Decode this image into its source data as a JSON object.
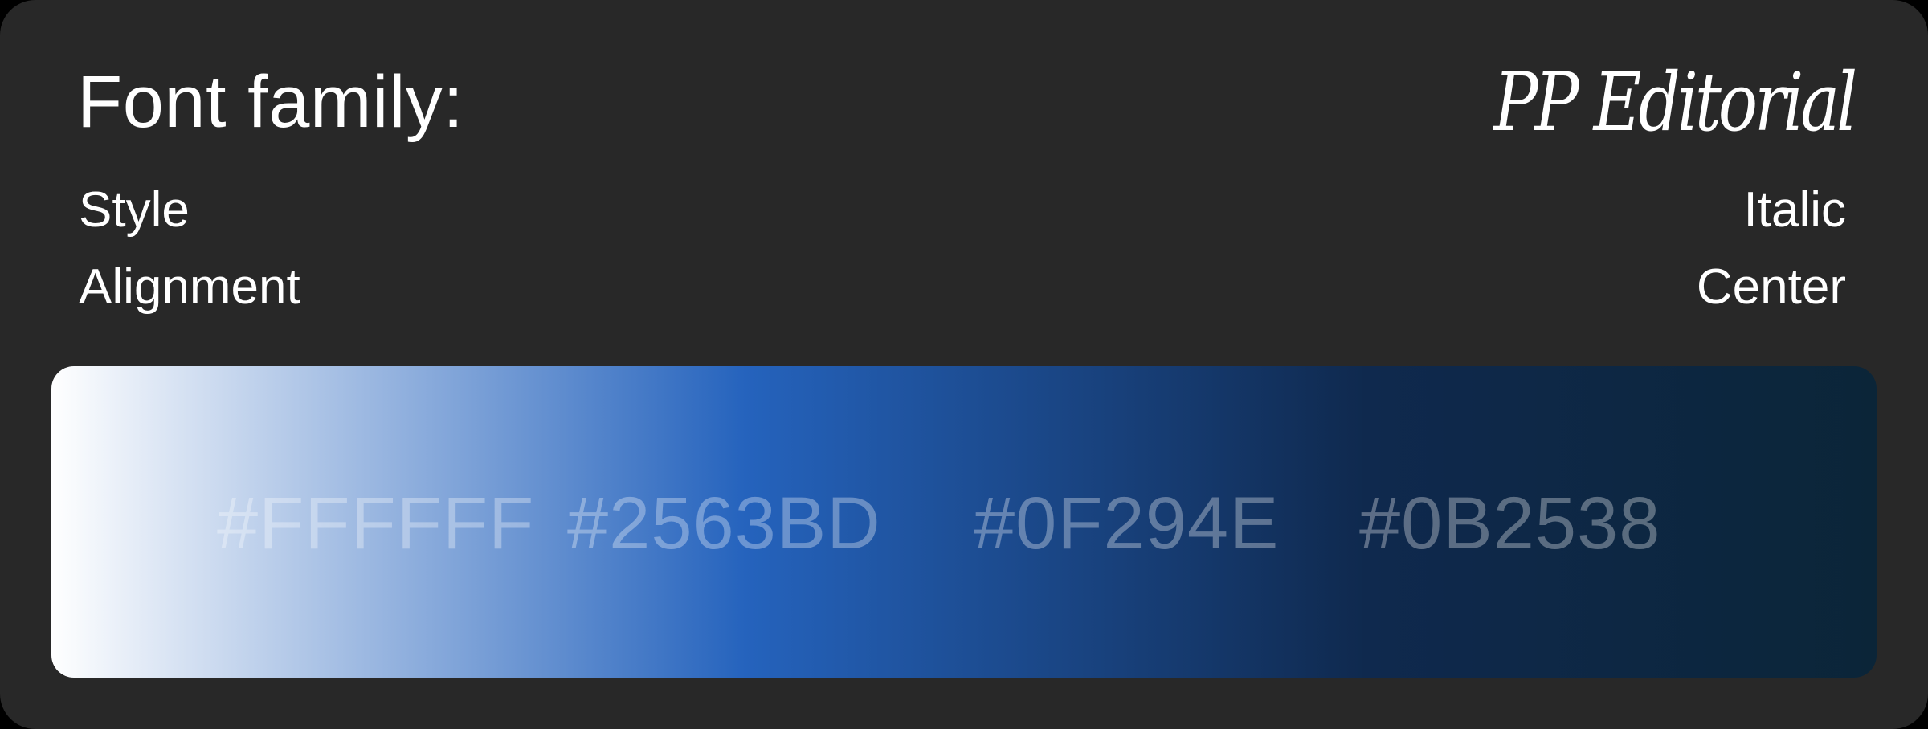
{
  "font_spec": {
    "title_label": "Font family:",
    "title_value": "PP Editorial",
    "style_label": "Style",
    "style_value": "Italic",
    "alignment_label": "Alignment",
    "alignment_value": "Center"
  },
  "gradient": {
    "colors": [
      "#FFFFFF",
      "#2563BD",
      "#0F294E",
      "#0B2538"
    ],
    "codes": [
      "#FFFFFF",
      "#2563BD",
      "#0F294E",
      "#0B2538"
    ]
  },
  "theme": {
    "background": "#282828",
    "text": "#FFFFFF"
  }
}
